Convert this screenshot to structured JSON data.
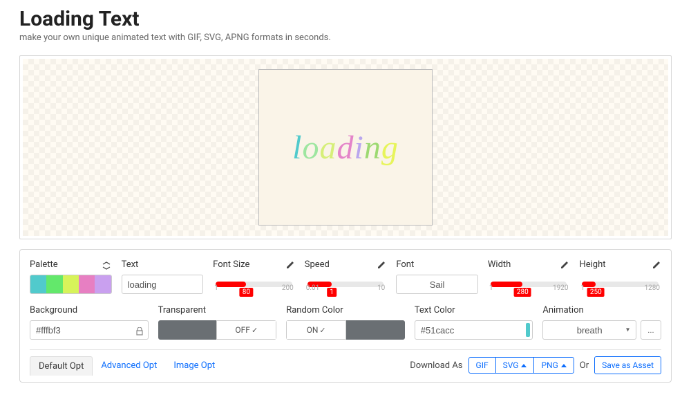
{
  "header": {
    "title": "Loading Text",
    "subtitle": "make your own unique animated text with GIF, SVG, APNG formats in seconds."
  },
  "preview": {
    "text": "loading",
    "letter_colors": [
      "#51cacc",
      "#9ee6a0",
      "#d6ef79",
      "#e484c9",
      "#b9a6ee",
      "#9cd971",
      "#e7f45b"
    ],
    "bg_color": "#fffbf3"
  },
  "controls": {
    "palette": {
      "label": "Palette",
      "swatches": [
        "#51cacc",
        "#63e86b",
        "#d7f35a",
        "#e77fc2",
        "#c9a0ef"
      ]
    },
    "text": {
      "label": "Text",
      "value": "loading"
    },
    "font_size": {
      "label": "Font Size",
      "min": "1",
      "max": "200",
      "value": "80",
      "fill_pct": 40
    },
    "speed": {
      "label": "Speed",
      "min": "0.01",
      "max": "10",
      "value": "1",
      "fill_pct": 32
    },
    "font": {
      "label": "Font",
      "value": "Sail"
    },
    "width": {
      "label": "Width",
      "min": "1",
      "max": "1920",
      "value": "280",
      "fill_pct": 42
    },
    "height": {
      "label": "Height",
      "min": "1",
      "max": "1280",
      "value": "250",
      "fill_pct": 18
    },
    "background": {
      "label": "Background",
      "value": "#fffbf3"
    },
    "transparent": {
      "label": "Transparent",
      "value": "OFF"
    },
    "random_color": {
      "label": "Random Color",
      "value": "ON"
    },
    "text_color": {
      "label": "Text Color",
      "value": "#51cacc",
      "swatch": "#51cacc"
    },
    "animation": {
      "label": "Animation",
      "value": "breath"
    }
  },
  "tabs": {
    "default_opt": "Default Opt",
    "advanced_opt": "Advanced Opt",
    "image_opt": "Image Opt"
  },
  "footer": {
    "download_as": "Download As",
    "formats": [
      "GIF",
      "SVG",
      "PNG"
    ],
    "or": "Or",
    "save_asset": "Save as Asset"
  }
}
